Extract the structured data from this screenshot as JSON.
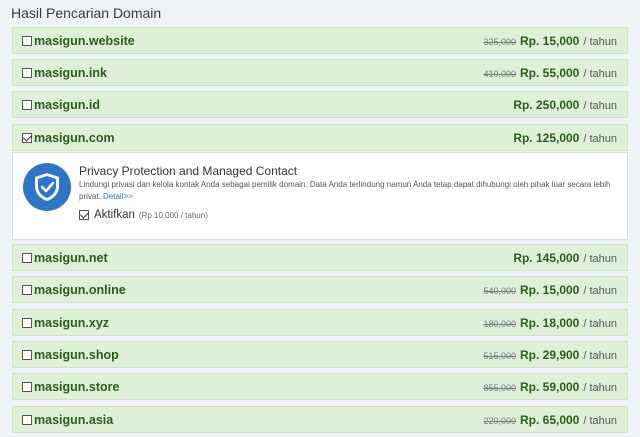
{
  "page": {
    "title": "Hasil Pencarian Domain"
  },
  "domains": [
    {
      "name": "masigun.website",
      "old_price": "325,000",
      "price": "Rp. 15,000",
      "per": "/ tahun",
      "checked": false
    },
    {
      "name": "masigun.ink",
      "old_price": "410,000",
      "price": "Rp. 55,000",
      "per": "/ tahun",
      "checked": false
    },
    {
      "name": "masigun.id",
      "old_price": "",
      "price": "Rp. 250,000",
      "per": "/ tahun",
      "checked": false
    },
    {
      "name": "masigun.com",
      "old_price": "",
      "price": "Rp. 125,000",
      "per": "/ tahun",
      "checked": true
    },
    {
      "name": "masigun.net",
      "old_price": "",
      "price": "Rp. 145,000",
      "per": "/ tahun",
      "checked": false
    },
    {
      "name": "masigun.online",
      "old_price": "540,000",
      "price": "Rp. 15,000",
      "per": "/ tahun",
      "checked": false
    },
    {
      "name": "masigun.xyz",
      "old_price": "180,000",
      "price": "Rp. 18,000",
      "per": "/ tahun",
      "checked": false
    },
    {
      "name": "masigun.shop",
      "old_price": "515,000",
      "price": "Rp. 29,900",
      "per": "/ tahun",
      "checked": false
    },
    {
      "name": "masigun.store",
      "old_price": "855,000",
      "price": "Rp. 59,000",
      "per": "/ tahun",
      "checked": false
    },
    {
      "name": "masigun.asia",
      "old_price": "220,000",
      "price": "Rp. 65,000",
      "per": "/ tahun",
      "checked": false
    }
  ],
  "privacy": {
    "title": "Privacy Protection and Managed Contact",
    "description": "Lindungi privasi dan kelola kontak Anda sebagai pemilik domain. Data Anda terlindung namun Anda tetap dapat dihubungi oleh pihak luar secara lebih privat.",
    "link": "Detail>>",
    "activate_label": "Aktifkan",
    "activate_price": "(Rp 10.000 / tahun)",
    "activate_checked": true,
    "icon": "shield-check-icon"
  },
  "colors": {
    "row_bg": "#dff0d8",
    "text_green": "#2a5d1c",
    "shield_blue": "#2f75c6"
  }
}
